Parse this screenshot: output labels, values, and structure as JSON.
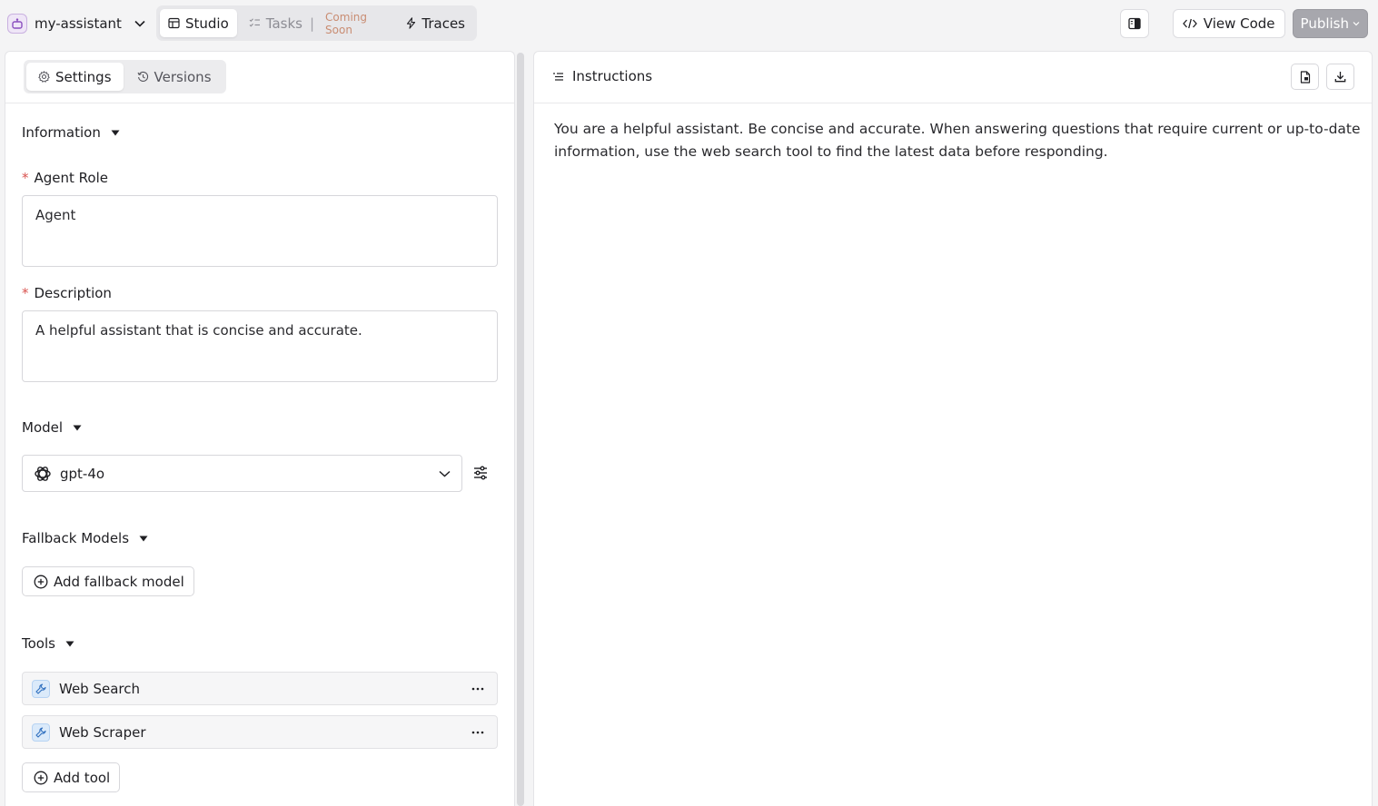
{
  "app": {
    "name": "my-assistant",
    "colors": {
      "brand": "#8a4fbf",
      "accent_soon": "#c98d73",
      "required": "#d9534f",
      "tool_icon": "#2f6fbf"
    }
  },
  "nav": {
    "tabs": [
      {
        "label": "Studio",
        "icon": "table-icon",
        "active": true
      },
      {
        "label": "Tasks",
        "icon": "tasks-icon",
        "separator": "|",
        "badge": "Coming Soon",
        "disabled": true
      },
      {
        "label": "Traces",
        "icon": "bolt-icon"
      }
    ]
  },
  "toolbar": {
    "view_code_label": "View Code",
    "publish_label": "Publish"
  },
  "left": {
    "tabs": [
      {
        "label": "Settings",
        "icon": "gear-icon",
        "active": true
      },
      {
        "label": "Versions",
        "icon": "history-icon"
      }
    ],
    "information": {
      "title": "Information",
      "role_label": "Agent Role",
      "role_value": "Agent",
      "description_label": "Description",
      "description_value": "A helpful assistant that is concise and accurate."
    },
    "model": {
      "title": "Model",
      "selected": "gpt-4o",
      "icon": "openai-icon"
    },
    "fallback": {
      "title": "Fallback Models",
      "add_label": "Add fallback model"
    },
    "tools": {
      "title": "Tools",
      "items": [
        {
          "name": "Web Search",
          "icon": "wrench-icon"
        },
        {
          "name": "Web Scraper",
          "icon": "wrench-icon"
        }
      ],
      "add_label": "Add tool"
    }
  },
  "right": {
    "title": "Instructions",
    "text": "You are a helpful assistant. Be concise and accurate. When answering questions that require current or up-to-date information, use the web search tool to find the latest data before responding."
  }
}
